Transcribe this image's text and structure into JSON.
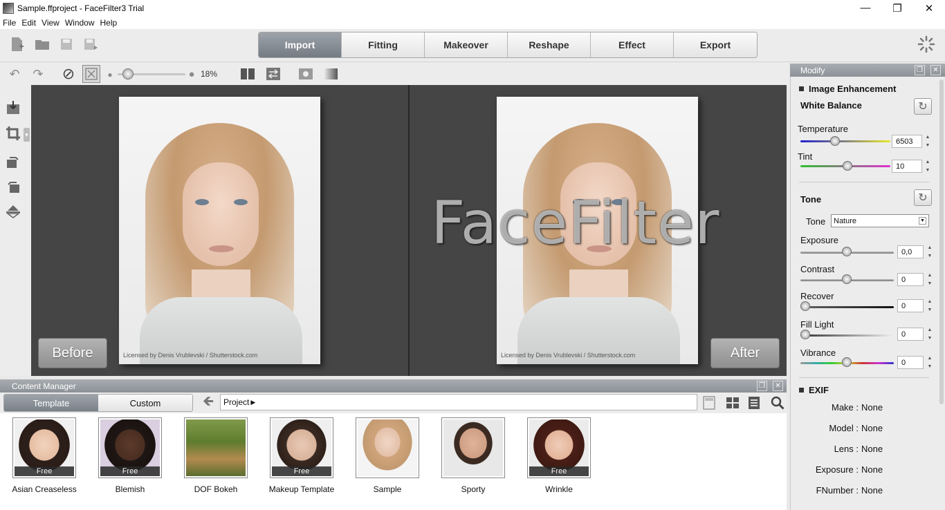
{
  "window": {
    "title": "Sample.ffproject - FaceFilter3 Trial"
  },
  "menu": [
    "File",
    "Edit",
    "View",
    "Window",
    "Help"
  ],
  "tabs": [
    {
      "label": "Import",
      "active": true
    },
    {
      "label": "Fitting",
      "active": false
    },
    {
      "label": "Makeover",
      "active": false
    },
    {
      "label": "Reshape",
      "active": false
    },
    {
      "label": "Effect",
      "active": false
    },
    {
      "label": "Export",
      "active": false
    }
  ],
  "zoom": {
    "value_label": "18%",
    "fraction": 0.18
  },
  "canvas": {
    "before_label": "Before",
    "after_label": "After",
    "watermark": "FaceFilter",
    "credit": "Licensed by Denis Vrublevski / Shutterstock.com"
  },
  "content_manager": {
    "title": "Content Manager",
    "tabs": [
      {
        "label": "Template",
        "active": true
      },
      {
        "label": "Custom",
        "active": false
      }
    ],
    "path": "Project",
    "items": [
      {
        "label": "Asian Creaseless",
        "badge": "Free"
      },
      {
        "label": "Blemish",
        "badge": "Free"
      },
      {
        "label": "DOF Bokeh",
        "badge": ""
      },
      {
        "label": "Makeup Template",
        "badge": "Free"
      },
      {
        "label": "Sample",
        "badge": ""
      },
      {
        "label": "Sporty",
        "badge": ""
      },
      {
        "label": "Wrinkle",
        "badge": "Free"
      }
    ]
  },
  "modify": {
    "title": "Modify",
    "image_enhancement": "Image Enhancement",
    "white_balance": "White Balance",
    "temperature": {
      "label": "Temperature",
      "value": "6503",
      "fraction": 0.4
    },
    "tint": {
      "label": "Tint",
      "value": "10",
      "fraction": 0.52
    },
    "tone_head": "Tone",
    "tone_select": {
      "label": "Tone",
      "value": "Nature"
    },
    "exposure": {
      "label": "Exposure",
      "value": "0,0",
      "fraction": 0.5
    },
    "contrast": {
      "label": "Contrast",
      "value": "0",
      "fraction": 0.5
    },
    "recover": {
      "label": "Recover",
      "value": "0",
      "fraction": 0.0
    },
    "fill_light": {
      "label": "Fill Light",
      "value": "0",
      "fraction": 0.0
    },
    "vibrance": {
      "label": "Vibrance",
      "value": "0",
      "fraction": 0.5
    },
    "exif_head": "EXIF",
    "exif": [
      {
        "key": "Make :",
        "value": "None"
      },
      {
        "key": "Model :",
        "value": "None"
      },
      {
        "key": "Lens :",
        "value": "None"
      },
      {
        "key": "Exposure :",
        "value": "None"
      },
      {
        "key": "FNumber :",
        "value": "None"
      }
    ]
  }
}
